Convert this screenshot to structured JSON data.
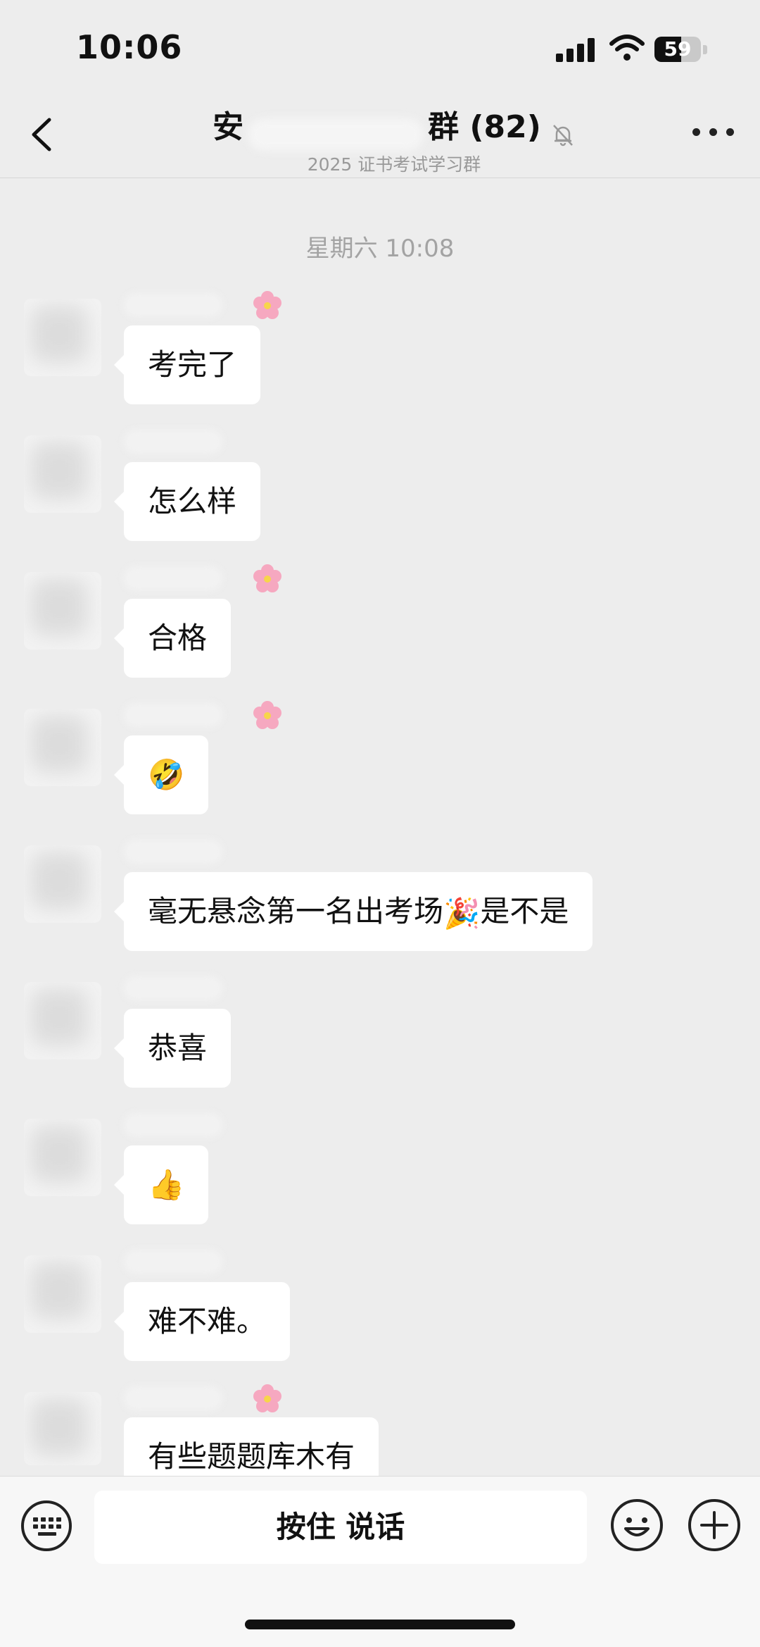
{
  "status_bar": {
    "time": "10:06",
    "battery": "59"
  },
  "header": {
    "title_prefix": "安",
    "title_suffix": "群 (82)",
    "subtitle": "2025 证书考试学习群"
  },
  "chat": {
    "timestamp": "星期六 10:08",
    "messages": [
      {
        "text": "考完了"
      },
      {
        "text": "怎么样"
      },
      {
        "text": "合格"
      },
      {
        "text": "🤣"
      },
      {
        "text_before": "毫无悬念第一名出考场",
        "emoji": "🎉",
        "text_after": "是不是"
      },
      {
        "text": "恭喜"
      },
      {
        "text": "👍"
      },
      {
        "text": "难不难。"
      },
      {
        "text": "有些题题库木有"
      }
    ]
  },
  "input_bar": {
    "hold_to_talk": "按住 说话"
  }
}
